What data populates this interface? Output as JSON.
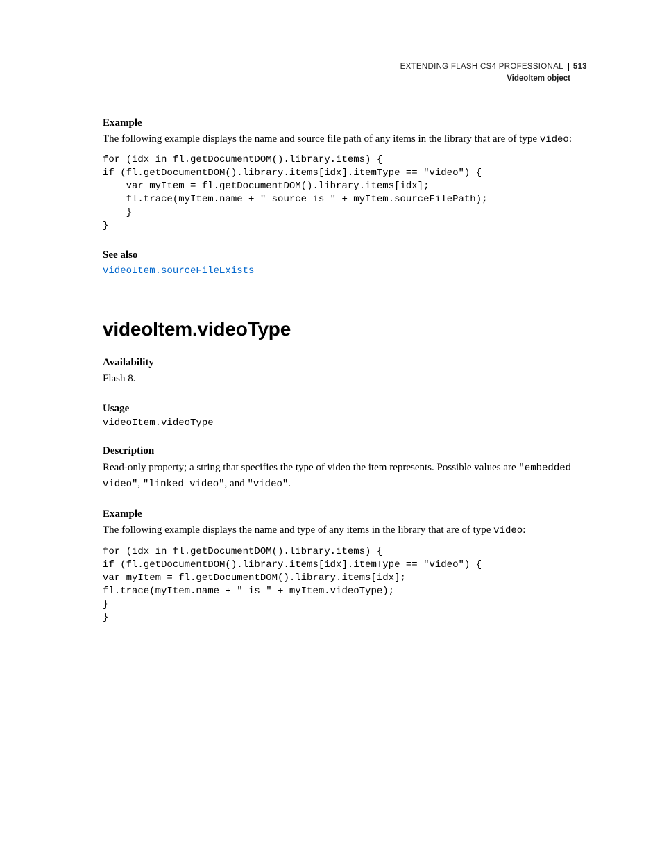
{
  "header": {
    "book_title": "EXTENDING FLASH CS4 PROFESSIONAL",
    "section": "VideoItem object",
    "page_number": "513"
  },
  "section1": {
    "example_heading": "Example",
    "example_intro_a": "The following example displays the name and source file path of any items in the library that are of type ",
    "example_intro_code": "video",
    "example_intro_b": ":",
    "code": "for (idx in fl.getDocumentDOM().library.items) {\nif (fl.getDocumentDOM().library.items[idx].itemType == \"video\") {\n    var myItem = fl.getDocumentDOM().library.items[idx];\n    fl.trace(myItem.name + \" source is \" + myItem.sourceFilePath);\n    }\n}",
    "see_also_heading": "See also",
    "see_also_link": "videoItem.sourceFileExists"
  },
  "section2": {
    "title": "videoItem.videoType",
    "availability_heading": "Availability",
    "availability_text": "Flash 8.",
    "usage_heading": "Usage",
    "usage_code": "videoItem.videoType",
    "description_heading": "Description",
    "description_a": "Read-only property; a string that specifies the type of video the item represents. Possible values are ",
    "desc_code1": "\"embedded video\"",
    "desc_sep1": ", ",
    "desc_code2": "\"linked video\"",
    "desc_sep2": ", and ",
    "desc_code3": "\"video\"",
    "desc_end": ".",
    "example_heading": "Example",
    "example_intro_a": "The following example displays the name and type of any items in the library that are of type ",
    "example_intro_code": "video",
    "example_intro_b": ":",
    "code": "for (idx in fl.getDocumentDOM().library.items) {\nif (fl.getDocumentDOM().library.items[idx].itemType == \"video\") {\nvar myItem = fl.getDocumentDOM().library.items[idx];\nfl.trace(myItem.name + \" is \" + myItem.videoType);\n}\n}"
  }
}
